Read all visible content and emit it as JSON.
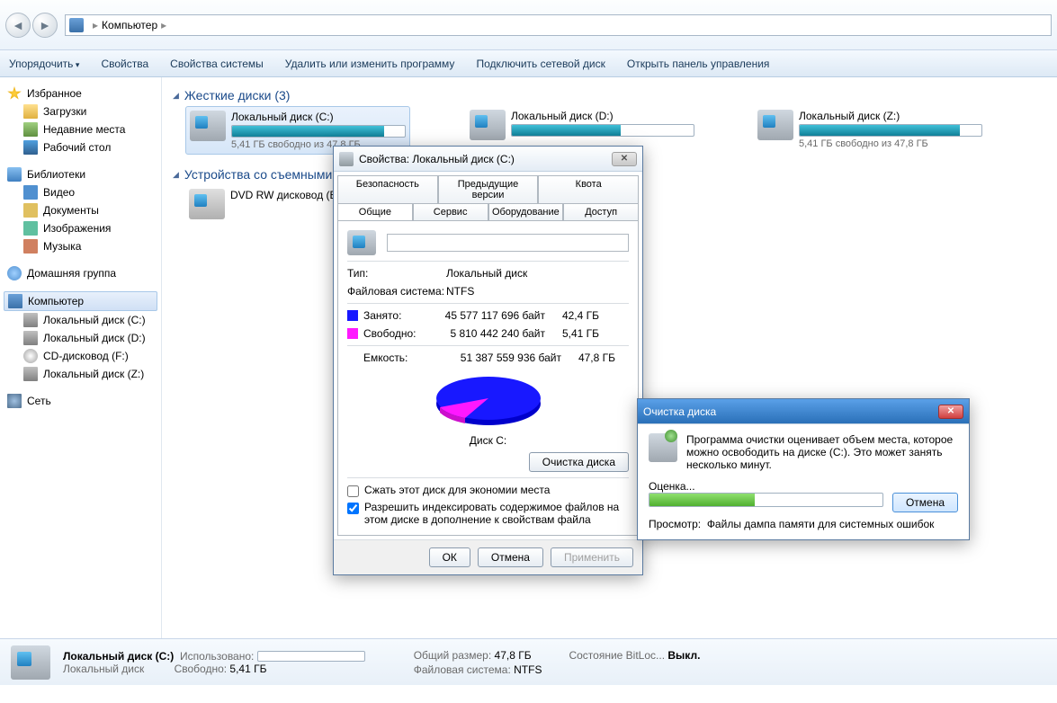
{
  "breadcrumb": {
    "root": "Компьютер"
  },
  "toolbar": {
    "organize": "Упорядочить",
    "properties": "Свойства",
    "sysprops": "Свойства системы",
    "uninstall": "Удалить или изменить программу",
    "mapdrive": "Подключить сетевой диск",
    "controlpanel": "Открыть панель управления"
  },
  "sidebar": {
    "favorites": "Избранное",
    "downloads": "Загрузки",
    "recent": "Недавние места",
    "desktop": "Рабочий стол",
    "libraries": "Библиотеки",
    "videos": "Видео",
    "documents": "Документы",
    "pictures": "Изображения",
    "music": "Музыка",
    "homegroup": "Домашняя группа",
    "computer": "Компьютер",
    "driveC": "Локальный диск (C:)",
    "driveD": "Локальный диск (D:)",
    "driveF": "CD-дисковод (F:)",
    "driveZ": "Локальный диск (Z:)",
    "network": "Сеть"
  },
  "sections": {
    "hdd": "Жесткие диски (3)",
    "removable": "Устройства со съемными носителями"
  },
  "drives": {
    "c": {
      "name": "Локальный диск (C:)",
      "free": "5,41 ГБ свободно из 47,8 ГБ"
    },
    "d": {
      "name": "Локальный диск (D:)",
      "free": ""
    },
    "z": {
      "name": "Локальный диск (Z:)",
      "free": "5,41 ГБ свободно из 47,8 ГБ"
    },
    "dvd": {
      "name": "DVD RW дисковод (E:)"
    }
  },
  "status": {
    "title": "Локальный диск (C:)",
    "sub": "Локальный диск",
    "used_l": "Использовано:",
    "free_l": "Свободно:",
    "free_v": "5,41 ГБ",
    "total_l": "Общий размер:",
    "total_v": "47,8 ГБ",
    "fs_l": "Файловая система:",
    "fs_v": "NTFS",
    "bitlocker_l": "Состояние BitLoc...",
    "bitlocker_v": "Выкл."
  },
  "prop": {
    "title": "Свойства: Локальный диск (C:)",
    "tabs": {
      "security": "Безопасность",
      "prev": "Предыдущие версии",
      "quota": "Квота",
      "general": "Общие",
      "tools": "Сервис",
      "hardware": "Оборудование",
      "sharing": "Доступ"
    },
    "type_l": "Тип:",
    "type_v": "Локальный диск",
    "fs_l": "Файловая система:",
    "fs_v": "NTFS",
    "used_l": "Занято:",
    "used_b": "45 577 117 696 байт",
    "used_g": "42,4 ГБ",
    "free_l": "Свободно:",
    "free_b": "5 810 442 240 байт",
    "free_g": "5,41 ГБ",
    "cap_l": "Емкость:",
    "cap_b": "51 387 559 936 байт",
    "cap_g": "47,8 ГБ",
    "pie_label": "Диск C:",
    "cleanup_btn": "Очистка диска",
    "compress": "Сжать этот диск для экономии места",
    "index": "Разрешить индексировать содержимое файлов на этом диске в дополнение к свойствам файла",
    "ok": "ОК",
    "cancel": "Отмена",
    "apply": "Применить"
  },
  "clean": {
    "title": "Очистка диска",
    "msg": "Программа очистки оценивает объем места, которое можно освободить на диске  (C:). Это может занять несколько минут.",
    "eval": "Оценка...",
    "cancel": "Отмена",
    "view_l": "Просмотр:",
    "view_v": "Файлы дампа памяти для системных ошибок"
  }
}
